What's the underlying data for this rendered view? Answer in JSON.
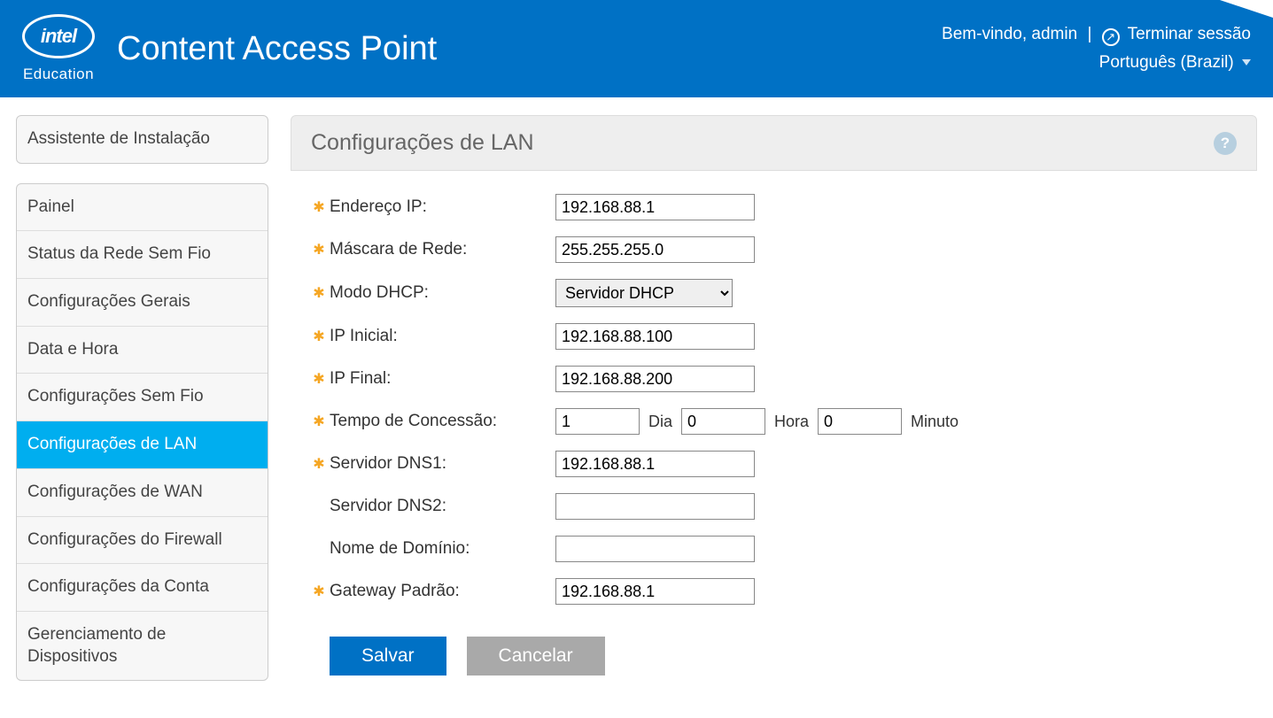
{
  "header": {
    "logo_text": "intel",
    "edu_label": "Education",
    "app_title": "Content Access Point",
    "welcome": "Bem-vindo, admin",
    "logout": "Terminar sessão",
    "language": "Português (Brazil)"
  },
  "sidebar": {
    "top_item": "Assistente de Instalação",
    "items": [
      "Painel",
      "Status da Rede Sem Fio",
      "Configurações Gerais",
      "Data e Hora",
      "Configurações Sem Fio",
      "Configurações de LAN",
      "Configurações de WAN",
      "Configurações do Firewall",
      "Configurações da Conta",
      "Gerenciamento de Dispositivos"
    ],
    "active_index": 5
  },
  "panel": {
    "title": "Configurações de LAN"
  },
  "form": {
    "ip_label": "Endereço IP:",
    "ip_value": "192.168.88.1",
    "netmask_label": "Máscara de Rede:",
    "netmask_value": "255.255.255.0",
    "dhcp_mode_label": "Modo DHCP:",
    "dhcp_mode_value": "Servidor DHCP",
    "ip_start_label": "IP Inicial:",
    "ip_start_value": "192.168.88.100",
    "ip_end_label": "IP Final:",
    "ip_end_value": "192.168.88.200",
    "lease_label": "Tempo de Concessão:",
    "lease_day": "1",
    "lease_day_unit": "Dia",
    "lease_hour": "0",
    "lease_hour_unit": "Hora",
    "lease_min": "0",
    "lease_min_unit": "Minuto",
    "dns1_label": "Servidor DNS1:",
    "dns1_value": "192.168.88.1",
    "dns2_label": "Servidor DNS2:",
    "dns2_value": "",
    "domain_label": "Nome de Domínio:",
    "domain_value": "",
    "gateway_label": "Gateway Padrão:",
    "gateway_value": "192.168.88.1",
    "save_btn": "Salvar",
    "cancel_btn": "Cancelar"
  }
}
